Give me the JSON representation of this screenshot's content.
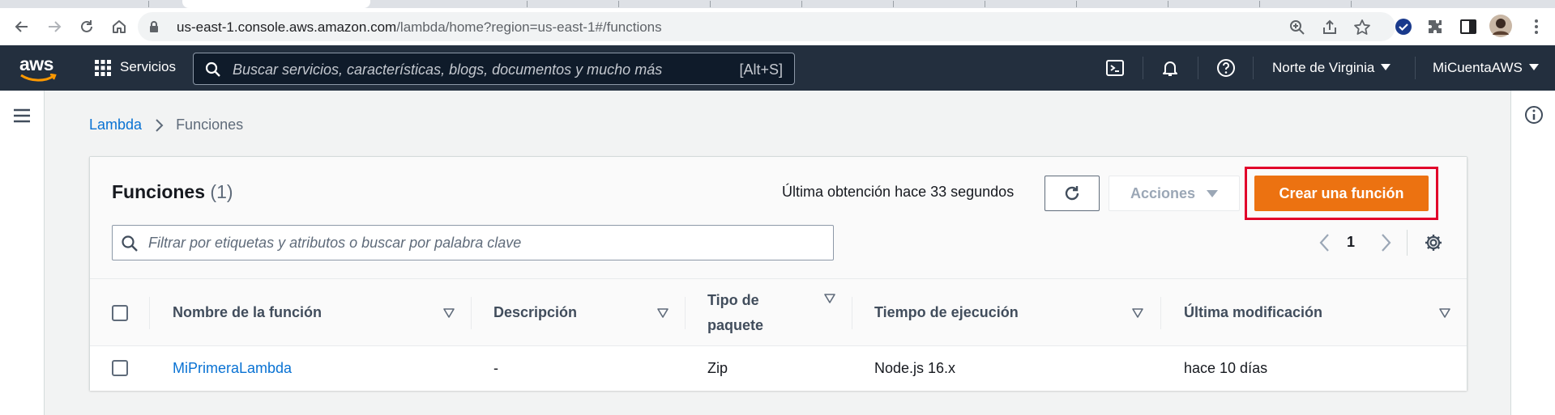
{
  "browser": {
    "url_host": "us-east-1.console.aws.amazon.com",
    "url_path": "/lambda/home?region=us-east-1#/functions"
  },
  "aws_nav": {
    "logo_text": "aws",
    "services_label": "Servicios",
    "search_placeholder": "Buscar servicios, características, blogs, documentos y mucho más",
    "search_shortcut": "[Alt+S]",
    "region_label": "Norte de Virginia",
    "account_label": "MiCuentaAWS"
  },
  "breadcrumb": {
    "root": "Lambda",
    "current": "Funciones"
  },
  "functions_panel": {
    "title": "Funciones",
    "count": "(1)",
    "last_fetch": "Última obtención hace 33 segundos",
    "actions_label": "Acciones",
    "create_label": "Crear una función",
    "filter_placeholder": "Filtrar por etiquetas y atributos o buscar por palabra clave",
    "page_number": "1",
    "columns": {
      "name": "Nombre de la función",
      "description": "Descripción",
      "package_type_line1": "Tipo de",
      "package_type_line2": "paquete",
      "runtime": "Tiempo de ejecución",
      "last_modified": "Última modificación"
    },
    "rows": [
      {
        "name": "MiPrimeraLambda",
        "description": "-",
        "package_type": "Zip",
        "runtime": "Node.js 16.x",
        "last_modified": "hace 10 días"
      }
    ]
  },
  "colors": {
    "aws_nav_bg": "#232f3e",
    "primary_button": "#ec7211",
    "link": "#0972d3",
    "highlight_box": "#e1002a"
  }
}
